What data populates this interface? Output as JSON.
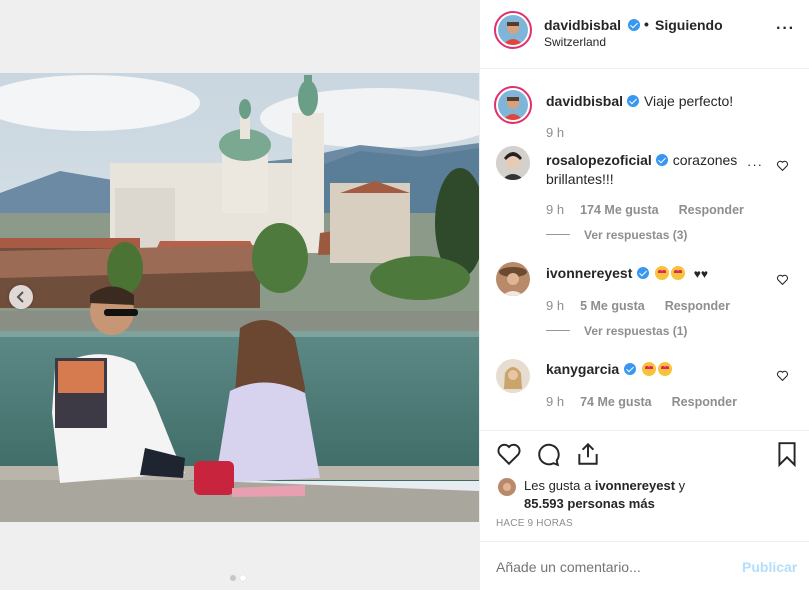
{
  "post": {
    "username": "davidbisbal",
    "dot": "•",
    "follow_state": "Siguiendo",
    "location": "Switzerland",
    "more": "···"
  },
  "caption": {
    "username": "davidbisbal",
    "text": "Viaje perfecto!",
    "time": "9 h"
  },
  "comments": [
    {
      "username": "rosalopezoficial",
      "text_line1": "corazones",
      "text_line2": "brillantes!!!",
      "more": "···",
      "time": "9 h",
      "likes": "174 Me gusta",
      "reply": "Responder",
      "view_replies": "Ver respuestas (3)"
    },
    {
      "username": "ivonnereyest",
      "text_suffix": "♥♥",
      "time": "9 h",
      "likes": "5 Me gusta",
      "reply": "Responder",
      "view_replies": "Ver respuestas (1)"
    },
    {
      "username": "kanygarcia",
      "time": "9 h",
      "likes": "74 Me gusta",
      "reply": "Responder"
    }
  ],
  "likes_summary": {
    "line1_prefix": "Les gusta a",
    "line1_user": "ivonnereyest",
    "line1_suffix": "y",
    "line2": "85.593 personas más"
  },
  "timestamp": "HACE 9 HORAS",
  "comment_input": {
    "placeholder": "Añade un comentario...",
    "publish": "Publicar"
  },
  "colors": {
    "verified": "#3897f0",
    "publish_disabled": "#b2dffc",
    "story_ring": "#e1306c"
  },
  "icons": [
    "chevron-left-icon",
    "heart-icon",
    "comment-icon",
    "share-icon",
    "bookmark-icon",
    "verified-icon",
    "more-icon",
    "heart-outline-icon"
  ]
}
